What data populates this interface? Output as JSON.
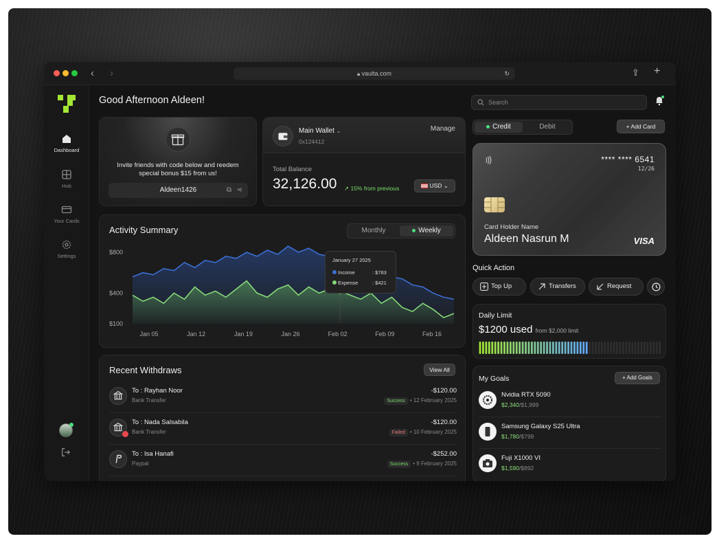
{
  "browser": {
    "url": "vaulta.com",
    "traffic_lights": [
      "#ff5f57",
      "#febc2e",
      "#28c840"
    ]
  },
  "sidebar": {
    "items": [
      {
        "label": "Dashboard",
        "icon": "home-icon",
        "active": true
      },
      {
        "label": "Hub",
        "icon": "grid-icon",
        "active": false
      },
      {
        "label": "Your Cards",
        "icon": "card-icon",
        "active": false
      },
      {
        "label": "Settings",
        "icon": "gear-icon",
        "active": false
      }
    ],
    "accent": "#a3e635"
  },
  "greeting": "Good Afternoon Aldeen!",
  "invite": {
    "text": "Invite friends with code below and reedem special bonus $15 from us!",
    "code": "Aldeen1426"
  },
  "wallet": {
    "name": "Main Wallet",
    "address": "0x124412",
    "manage_label": "Manage",
    "balance_label": "Total Balance",
    "balance": "32,126.00",
    "change": "15% from previous",
    "currency": "USD"
  },
  "activity": {
    "title": "Activity Summary",
    "tabs": [
      "Monthly",
      "Weekly"
    ],
    "active_tab": "Weekly",
    "tooltip": {
      "date": "January 27 2025",
      "income_label": "Income",
      "income_value": ": $783",
      "expense_label": "Expense",
      "expense_value": ": $421"
    }
  },
  "chart_data": {
    "type": "area",
    "x_ticks": [
      "Jan 05",
      "Jan 12",
      "Jan 19",
      "Jan 26",
      "Feb 02",
      "Feb 09",
      "Feb 16"
    ],
    "y_ticks": [
      "$800",
      "$400",
      "$100"
    ],
    "series": [
      {
        "name": "Income",
        "color": "#3b6fd4",
        "values": [
          560,
          600,
          580,
          640,
          620,
          700,
          650,
          720,
          700,
          760,
          740,
          800,
          760,
          820,
          780,
          860,
          800,
          840,
          780,
          760,
          783,
          720,
          700,
          640,
          600,
          560,
          540,
          480,
          460,
          400,
          360,
          340
        ]
      },
      {
        "name": "Expense",
        "color": "#86d97a",
        "values": [
          380,
          320,
          360,
          300,
          400,
          340,
          460,
          380,
          420,
          360,
          440,
          520,
          400,
          360,
          440,
          480,
          380,
          460,
          400,
          440,
          421,
          380,
          340,
          400,
          300,
          360,
          260,
          220,
          300,
          240,
          160,
          200
        ]
      }
    ]
  },
  "withdraws": {
    "title": "Recent Withdraws",
    "view_all": "View All",
    "rows": [
      {
        "to": "To : Rayhan Noor",
        "method": "Bank Transfer",
        "amount": "-$120.00",
        "status": "Success",
        "date": "• 12 February 2025"
      },
      {
        "to": "To : Nada Salsabila",
        "method": "Bank Transfer",
        "amount": "-$120.00",
        "status": "Failed",
        "date": "• 10 February 2025"
      },
      {
        "to": "To : Isa Hanafi",
        "method": "Paypal",
        "amount": "-$252.00",
        "status": "Success",
        "date": "• 9 February 2025"
      }
    ]
  },
  "search": {
    "placeholder": "Search"
  },
  "cards": {
    "tabs": [
      "Credit",
      "Debit"
    ],
    "active_tab": "Credit",
    "add_card": "Add Card",
    "number": "**** **** 6541",
    "expiry": "12/26",
    "holder_label": "Card Holder Name",
    "holder_name": "Aldeen Nasrun M",
    "brand": "VISA"
  },
  "quick_action": {
    "title": "Quick Action",
    "buttons": [
      "Top Up",
      "Transfers",
      "Request"
    ]
  },
  "daily_limit": {
    "title": "Daily Limit",
    "used": "$1200 used",
    "limit_text": "from $2,000 limit",
    "fraction": 0.6
  },
  "goals": {
    "title": "My Goals",
    "add_label": "Add Goals",
    "items": [
      {
        "name": "Nvidia RTX 5090",
        "current": "$2,340",
        "target": "/$1,999"
      },
      {
        "name": "Samsung Galaxy S25 Ultra",
        "current": "$1,780",
        "target": "/$799"
      },
      {
        "name": "Fuji X1000 VI",
        "current": "$1,590",
        "target": "/$892"
      }
    ]
  }
}
